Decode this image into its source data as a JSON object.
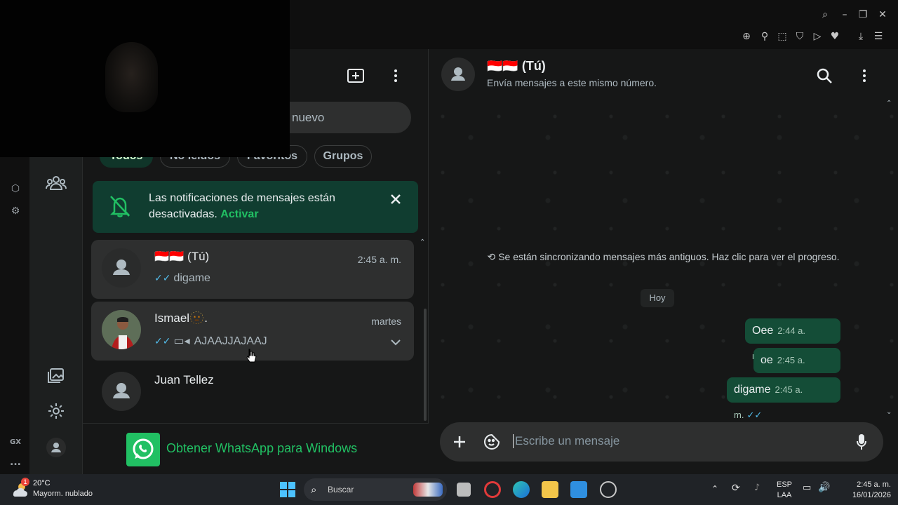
{
  "webcam": {
    "label": "webcam overlay"
  },
  "opera_sidebar": {
    "gx_label": "GX",
    "more_label": "..."
  },
  "filters": [
    {
      "label": "Todos",
      "active": true
    },
    {
      "label": "No leídos",
      "active": false
    },
    {
      "label": "Favoritos",
      "active": false
    },
    {
      "label": "Grupos",
      "active": false
    }
  ],
  "search": {
    "visible_text": "nuevo"
  },
  "notification": {
    "text": "Las notificaciones de mensajes están desactivadas.",
    "action": "Activar"
  },
  "chats": [
    {
      "name": "🇮🇩🇮🇩 (Tú)",
      "last_message": "digame",
      "time": "2:45 a. m.",
      "selected": true
    },
    {
      "name": "Ismael🫥.",
      "last_message": "AJAAJJAJAAJ",
      "time": "martes",
      "selected": false
    },
    {
      "name": "Juan Tellez",
      "last_message": "",
      "time": "",
      "selected": false
    }
  ],
  "get_whatsapp": {
    "label": "Obtener WhatsApp para Windows"
  },
  "chat_header": {
    "title": "🇮🇩🇮🇩 (Tú)",
    "subtitle": "Envía mensajes a este mismo número."
  },
  "sync_notice": "Se están sincronizando mensajes más antiguos. Haz clic para ver el progreso.",
  "date_divider": "Hoy",
  "messages": [
    {
      "text": "Oee",
      "time": "2:44 a. m."
    },
    {
      "text": "oe",
      "time": "2:45 a. m."
    },
    {
      "text": "digame",
      "time": "2:45 a. m."
    }
  ],
  "composer": {
    "placeholder": "Escribe un mensaje"
  },
  "taskbar": {
    "weather_temp": "20°C",
    "weather_desc": "Mayorm. nublado",
    "weather_badge": "1",
    "search_label": "Buscar",
    "lang_top": "ESP",
    "lang_bottom": "LAA",
    "time": "2:45 a. m.",
    "date": "16/01/2026"
  },
  "colors": {
    "accent_green": "#21c063",
    "bubble_green": "#144d37",
    "read_tick": "#53bdeb",
    "panel_bg": "#161717"
  }
}
